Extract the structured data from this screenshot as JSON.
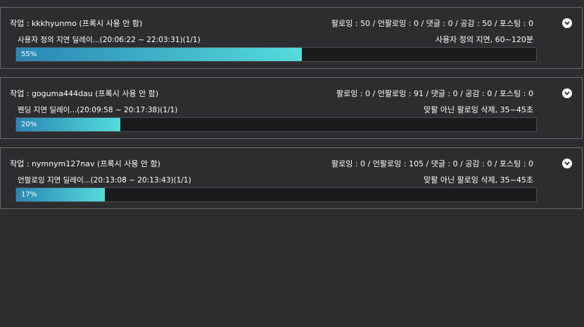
{
  "jobs": [
    {
      "title": "작업 : kkkhyunmo (프록시 사용 안 함)",
      "stats": "팔로잉 : 50 / 언팔로잉 : 0 / 댓글 : 0 / 공감 : 50 / 포스팅 : 0",
      "status": "사용자 정의 지연 딜레이...(20:06:22 ~ 22:03:31)(1/1)",
      "delay_note": "사용자 정의 지연, 60~120분",
      "progress": 0.55,
      "progress_label": "55%",
      "toggle_icon": "chevron-down-icon"
    },
    {
      "title": "작업 : goguma444dau (프록시 사용 안 함)",
      "stats": "팔로잉 : 0 / 언팔로잉 : 91 / 댓글 : 0 / 공감 : 0 / 포스팅 : 0",
      "status": "펜딩 지연 딜레이...(20:09:58 ~ 20:17:38)(1/1)",
      "delay_note": "맞팔 아닌 팔로잉 삭제, 35~45초",
      "progress": 0.2,
      "progress_label": "20%",
      "toggle_icon": "chevron-down-icon"
    },
    {
      "title": "작업 : nymnym127nav (프록시 사용 안 함)",
      "stats": "팔로잉 : 0 / 언팔로잉 : 105 / 댓글 : 0 / 공감 : 0 / 포스팅 : 0",
      "status": "언팔로잉 지연 딜레이...(20:13:08 ~ 20:13:43)(1/1)",
      "delay_note": "맞팔 아닌 팔로잉 삭제, 35~45초",
      "progress": 0.17,
      "progress_label": "17%",
      "toggle_icon": "chevron-down-icon"
    }
  ],
  "colors": {
    "background": "#2d2d30",
    "panel_border": "#6a6a6e",
    "progress_start": "#2a86b4",
    "progress_end": "#55dcdc",
    "track": "#1b1b1d"
  }
}
